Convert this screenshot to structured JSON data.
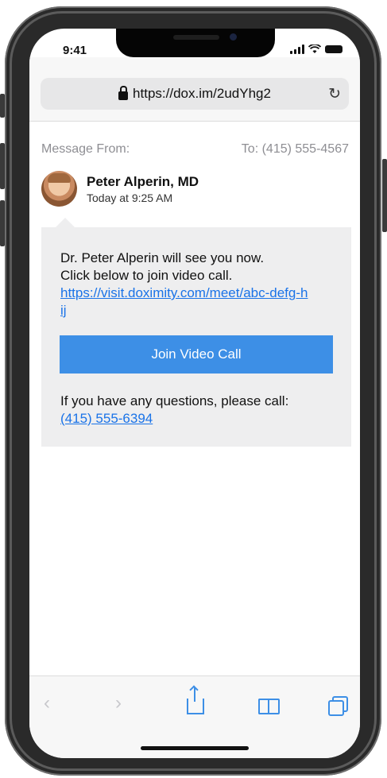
{
  "status_bar": {
    "time": "9:41"
  },
  "browser": {
    "url": "https://dox.im/2udYhg2",
    "lock_icon": "lock-icon",
    "reload_icon": "reload-icon"
  },
  "message": {
    "from_label": "Message From:",
    "to_label": "To: (415) 555-4567",
    "sender_name": "Peter Alperin, MD",
    "sender_time": "Today at 9:25 AM",
    "body_line1": "Dr. Peter Alperin will see you now.",
    "body_line2": "Click below to join video call.",
    "link": "https://visit.doximity.com/meet/abc-defg-hij",
    "button_label": "Join Video Call",
    "questions": "If you have any questions, please call:",
    "phone": "(415) 555-6394"
  },
  "toolbar": {
    "back": "‹",
    "forward": "›"
  },
  "colors": {
    "accent": "#3d8fe6",
    "link": "#1a73e8",
    "bubble": "#eeeeef"
  }
}
